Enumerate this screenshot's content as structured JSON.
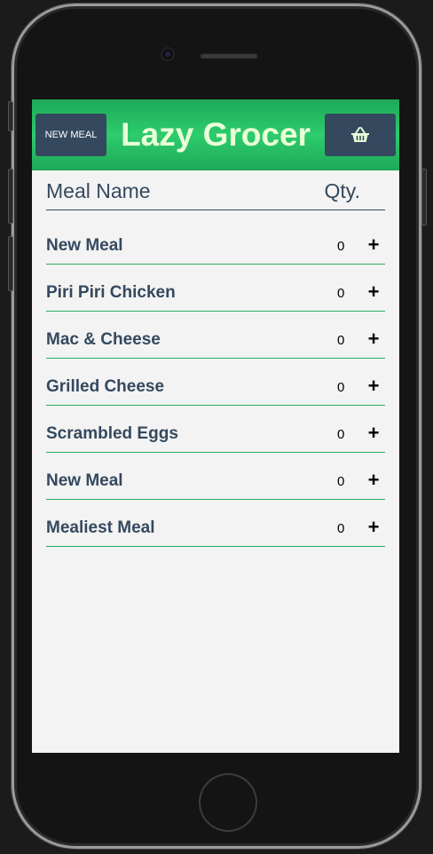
{
  "header": {
    "new_meal_label": "NEW MEAL",
    "title": "Lazy Grocer",
    "basket_icon": "basket-icon"
  },
  "columns": {
    "name": "Meal Name",
    "qty": "Qty."
  },
  "meals": [
    {
      "name": "New Meal",
      "qty": "0",
      "add": "+"
    },
    {
      "name": "Piri Piri Chicken",
      "qty": "0",
      "add": "+"
    },
    {
      "name": "Mac & Cheese",
      "qty": "0",
      "add": "+"
    },
    {
      "name": "Grilled Cheese",
      "qty": "0",
      "add": "+"
    },
    {
      "name": "Scrambled Eggs",
      "qty": "0",
      "add": "+"
    },
    {
      "name": "New Meal",
      "qty": "0",
      "add": "+"
    },
    {
      "name": "Mealiest Meal",
      "qty": "0",
      "add": "+"
    }
  ],
  "colors": {
    "header_green": "#2dcc6c",
    "button_navy": "#34495e",
    "title_text": "#e9ffd9",
    "row_divider": "#27ae60",
    "screen_bg": "#f3f3f3"
  }
}
